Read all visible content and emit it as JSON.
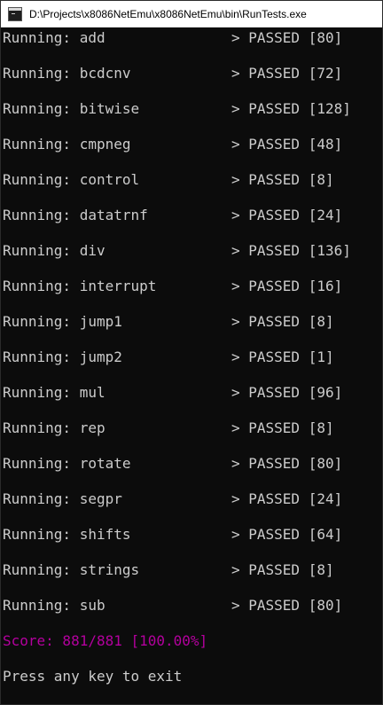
{
  "window": {
    "title": "D:\\Projects\\x8086NetEmu\\x8086NetEmu\\bin\\RunTests.exe",
    "icon": "console-app-icon"
  },
  "console": {
    "tests": [
      {
        "label": "Running: add",
        "result": "> PASSED [80]"
      },
      {
        "label": "Running: bcdcnv",
        "result": "> PASSED [72]"
      },
      {
        "label": "Running: bitwise",
        "result": "> PASSED [128]"
      },
      {
        "label": "Running: cmpneg",
        "result": "> PASSED [48]"
      },
      {
        "label": "Running: control",
        "result": "> PASSED [8]"
      },
      {
        "label": "Running: datatrnf",
        "result": "> PASSED [24]"
      },
      {
        "label": "Running: div",
        "result": "> PASSED [136]"
      },
      {
        "label": "Running: interrupt",
        "result": "> PASSED [16]"
      },
      {
        "label": "Running: jump1",
        "result": "> PASSED [8]"
      },
      {
        "label": "Running: jump2",
        "result": "> PASSED [1]"
      },
      {
        "label": "Running: mul",
        "result": "> PASSED [96]"
      },
      {
        "label": "Running: rep",
        "result": "> PASSED [8]"
      },
      {
        "label": "Running: rotate",
        "result": "> PASSED [80]"
      },
      {
        "label": "Running: segpr",
        "result": "> PASSED [24]"
      },
      {
        "label": "Running: shifts",
        "result": "> PASSED [64]"
      },
      {
        "label": "Running: strings",
        "result": "> PASSED [8]"
      },
      {
        "label": "Running: sub",
        "result": "> PASSED [80]"
      }
    ],
    "score": "Score: 881/881 [100.00%]",
    "prompt": "Press any key to exit"
  },
  "colors": {
    "background": "#0c0c0c",
    "text": "#cccccc",
    "score": "#b4009e"
  }
}
